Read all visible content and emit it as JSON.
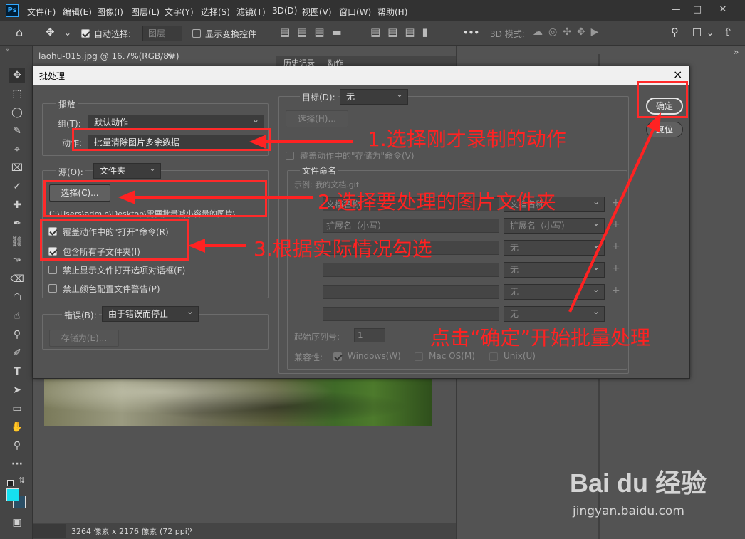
{
  "app": {
    "logo": "Ps",
    "menu": [
      "文件(F)",
      "编辑(E)",
      "图像(I)",
      "图层(L)",
      "文字(Y)",
      "选择(S)",
      "滤镜(T)",
      "3D(D)",
      "视图(V)",
      "窗口(W)",
      "帮助(H)"
    ]
  },
  "options": {
    "auto_select": "自动选择:",
    "layer": "图层",
    "show_transform": "显示变换控件",
    "mode3d": "3D 模式:",
    "more": "•••"
  },
  "document": {
    "tab": "laohu-015.jpg @ 16.7%(RGB/8#)",
    "close": "×",
    "status": "3264 像素 x 2176 像素 (72 ppi)"
  },
  "panels": {
    "history_tab": "历史记录",
    "actions_tab": "动作"
  },
  "dialog": {
    "title": "批处理",
    "close": "×",
    "play": {
      "legend": "播放",
      "group_label": "组(T):",
      "group_value": "默认动作",
      "action_label": "动作:",
      "action_value": "批量清除图片多余数据"
    },
    "source": {
      "label": "源(O):",
      "value": "文件夹",
      "choose": "选择(C)...",
      "path": "C:\\Users\\admin\\Desktop\\需要批量减小容量的图片\\",
      "opt1": "覆盖动作中的\"打开\"命令(R)",
      "opt2": "包含所有子文件夹(I)",
      "opt3": "禁止显示文件打开选项对话框(F)",
      "opt4": "禁止颜色配置文件警告(P)"
    },
    "error": {
      "label": "错误(B):",
      "value": "由于错误而停止",
      "save_as": "存储为(E)..."
    },
    "dest": {
      "label": "目标(D):",
      "value": "无",
      "choose": "选择(H)...",
      "override": "覆盖动作中的\"存储为\"命令(V)"
    },
    "naming": {
      "legend": "文件命名",
      "example": "示例: 我的文档.gif",
      "rows": [
        [
          "文档名称",
          "文档名称"
        ],
        [
          "扩展名（小写）",
          "扩展名（小写）"
        ],
        [
          "",
          "无"
        ],
        [
          "",
          "无"
        ],
        [
          "",
          "无"
        ],
        [
          "",
          "无"
        ]
      ],
      "start_label": "起始序列号:",
      "start_value": "1",
      "compat_label": "兼容性:",
      "windows": "Windows(W)",
      "mac": "Mac OS(M)",
      "unix": "Unix(U)"
    },
    "ok": "确定",
    "reset": "复位"
  },
  "annotations": {
    "a1": "1.选择刚才录制的动作",
    "a2": "2.选择要处理的图片文件夹",
    "a3": "3.根据实际情况勾选",
    "a4": "点击“确定”开始批量处理"
  },
  "watermark": {
    "logo": "Bai du 经验",
    "url": "jingyan.baidu.com"
  }
}
